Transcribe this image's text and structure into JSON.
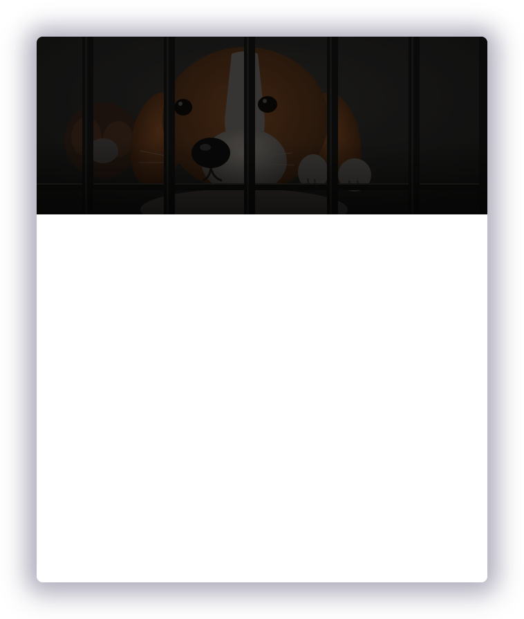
{
  "card": {
    "hero_image": {
      "subject": "puppy-behind-cage-bars",
      "colors": {
        "background": "#1d1d1b",
        "fur_brown": "#4a2c17",
        "fur_white": "#5a5754",
        "bars": "#0f0f0e",
        "nose": "#0b0b0b"
      }
    }
  }
}
